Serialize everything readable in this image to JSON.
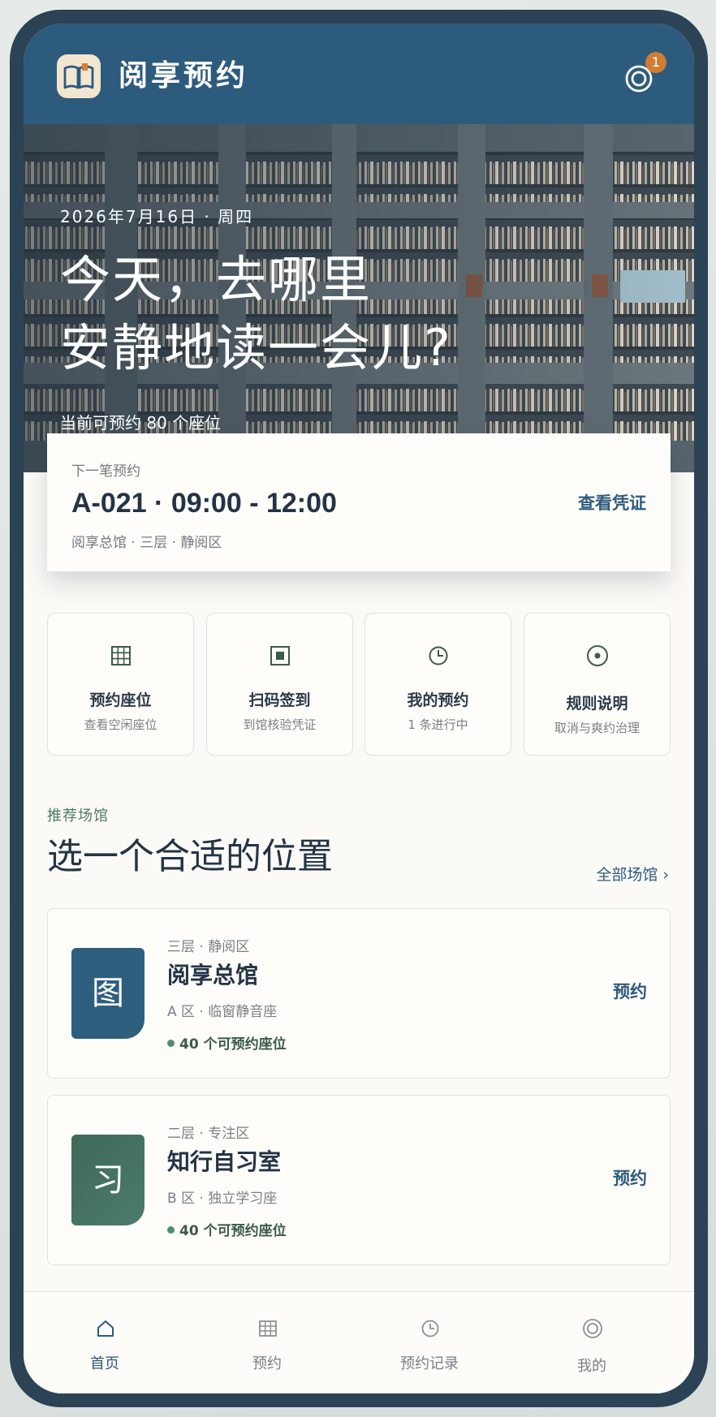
{
  "header": {
    "title": "阅享预约",
    "notifications": {
      "icon": "bell-icon",
      "count": "1"
    },
    "logo_icon": "book-icon"
  },
  "hero": {
    "date": "2026年7月16日 · 周四",
    "headline_line1": "今天，去哪里",
    "headline_line2": "安静地读一会儿?",
    "available": "当前可预约 80 个座位"
  },
  "next_booking": {
    "label": "下一笔预约",
    "detail": "A-021 · 09:00 - 12:00",
    "location": "阅享总馆 · 三层 · 静阅区",
    "action": "查看凭证"
  },
  "quick_actions": [
    {
      "title": "预约座位",
      "subtitle": "查看空闲座位",
      "icon": "grid-icon"
    },
    {
      "title": "扫码签到",
      "subtitle": "到馆核验凭证",
      "icon": "qr-scan-icon"
    },
    {
      "title": "我的预约",
      "subtitle": "1 条进行中",
      "icon": "clock-icon"
    },
    {
      "title": "规则说明",
      "subtitle": "取消与爽约治理",
      "icon": "target-icon"
    }
  ],
  "section": {
    "kicker": "推荐场馆",
    "title": "选一个合适的位置",
    "all_link": "全部场馆 ›"
  },
  "venues": [
    {
      "thumb": "图",
      "floor": "三层 · 静阅区",
      "name": "阅享总馆",
      "zone": "A 区 · 临窗静音座",
      "seats": "40 个可预约座位",
      "action": "预约",
      "color": "#2f5f7e"
    },
    {
      "thumb": "习",
      "floor": "二层 · 专注区",
      "name": "知行自习室",
      "zone": "B 区 · 独立学习座",
      "seats": "40 个可预约座位",
      "action": "预约",
      "color": "#3f6a5a"
    }
  ],
  "nav": [
    {
      "label": "首页",
      "icon": "home-icon",
      "active": true
    },
    {
      "label": "预约",
      "icon": "grid-icon",
      "active": false
    },
    {
      "label": "预约记录",
      "icon": "clock-icon",
      "active": false
    },
    {
      "label": "我的",
      "icon": "user-ring-icon",
      "active": false
    }
  ],
  "colors": {
    "primary": "#2d5b7d",
    "frame": "#2b4354",
    "accent": "#cf7d33",
    "success": "#4e9070",
    "background": "#fbfaf6"
  }
}
